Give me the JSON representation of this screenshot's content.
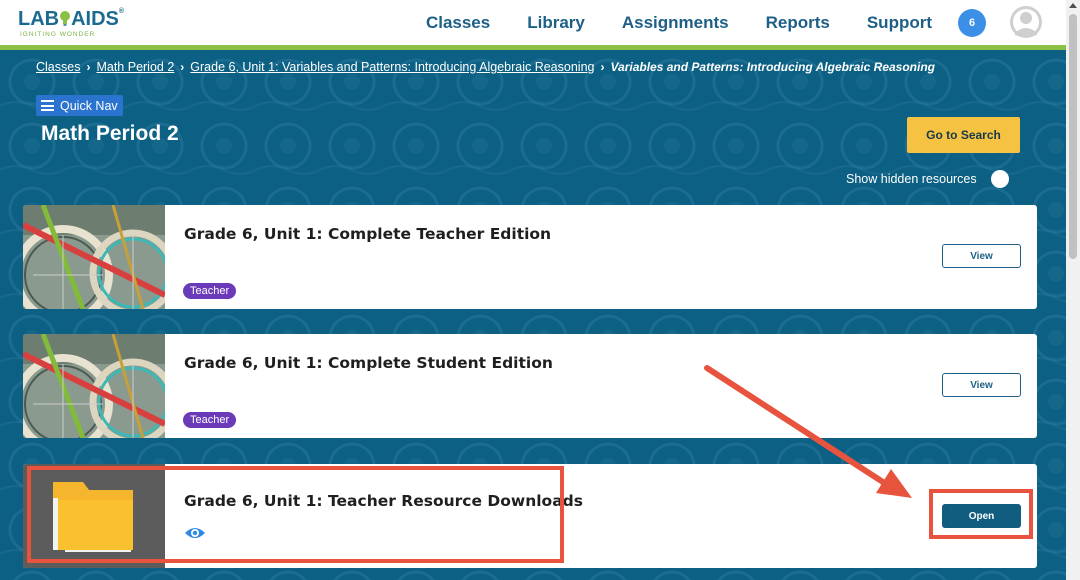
{
  "header": {
    "logo_text_left": "LAB",
    "logo_text_right": "AIDS",
    "logo_registered": "®",
    "logo_tagline": "IGNITING WONDER",
    "nav": [
      {
        "label": "Classes"
      },
      {
        "label": "Library"
      },
      {
        "label": "Assignments"
      },
      {
        "label": "Reports"
      },
      {
        "label": "Support"
      }
    ],
    "notification_count": "6",
    "avatar_icon": "user-avatar-icon"
  },
  "breadcrumb": {
    "items": [
      {
        "label": "Classes"
      },
      {
        "label": "Math Period 2"
      },
      {
        "label": "Grade 6, Unit 1: Variables and Patterns: Introducing Algebraic Reasoning"
      }
    ],
    "current": "Variables and Patterns: Introducing Algebraic Reasoning"
  },
  "quick_nav": {
    "label": "Quick Nav",
    "icon": "hamburger-icon"
  },
  "page_title": "Math Period 2",
  "go_to_search": {
    "label": "Go to Search"
  },
  "show_hidden": {
    "label": "Show hidden resources",
    "enabled": true
  },
  "cards": [
    {
      "title": "Grade 6, Unit 1: Complete Teacher Edition",
      "tag": "Teacher",
      "button": "View",
      "thumbnail": "bicycle-wheels-image"
    },
    {
      "title": "Grade 6, Unit 1: Complete Student Edition",
      "tag": "Teacher",
      "button": "View",
      "thumbnail": "bicycle-wheels-image"
    },
    {
      "title": "Grade 6, Unit 1: Teacher Resource Downloads",
      "button": "Open",
      "thumbnail": "folder-icon",
      "visibility_icon": "eye-icon"
    }
  ],
  "colors": {
    "brand_blue": "#1d5f86",
    "main_bg": "#0c6083",
    "accent_green": "#8cbf45",
    "search_yellow": "#f6c242",
    "tag_purple": "#6b3ab8",
    "annotation_red": "#e8533d",
    "badge_blue": "#3b8fe6"
  }
}
